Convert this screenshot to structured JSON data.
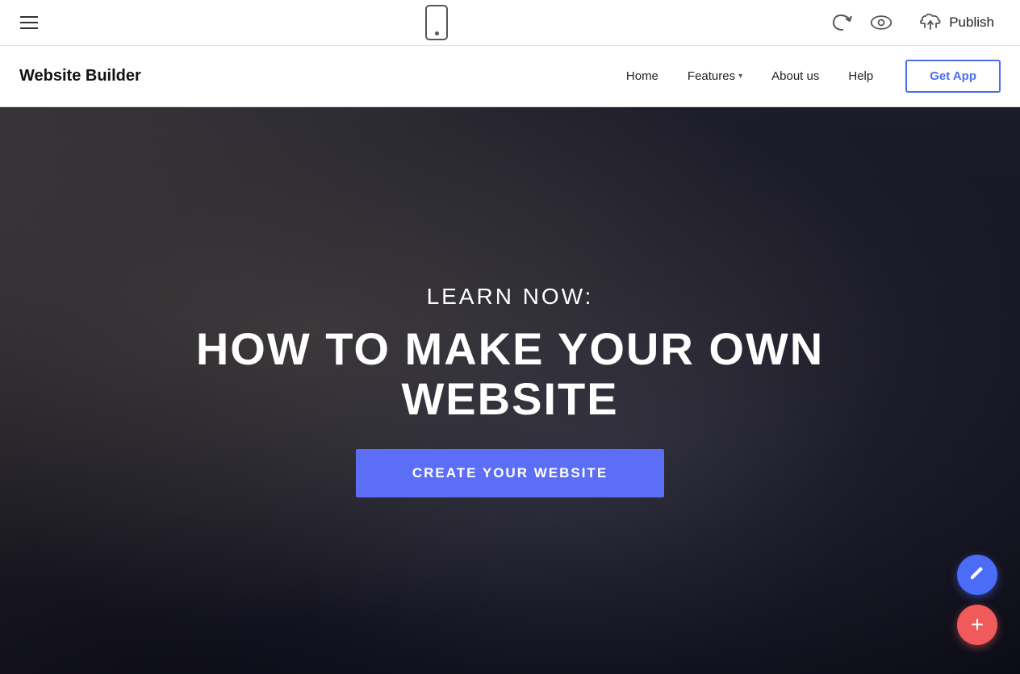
{
  "toolbar": {
    "hamburger_label": "menu",
    "undo_label": "undo",
    "eye_label": "preview",
    "publish_label": "Publish",
    "cloud_label": "cloud-upload"
  },
  "navbar": {
    "site_title": "Website Builder",
    "nav_links": [
      {
        "label": "Home",
        "has_dropdown": false
      },
      {
        "label": "Features",
        "has_dropdown": true
      },
      {
        "label": "About us",
        "has_dropdown": false
      },
      {
        "label": "Help",
        "has_dropdown": false
      }
    ],
    "cta_label": "Get App"
  },
  "hero": {
    "subtitle": "LEARN NOW:",
    "title": "HOW TO MAKE YOUR OWN WEBSITE",
    "cta_label": "CREATE YOUR WEBSITE"
  },
  "fab": {
    "edit_icon": "✎",
    "add_icon": "+"
  }
}
